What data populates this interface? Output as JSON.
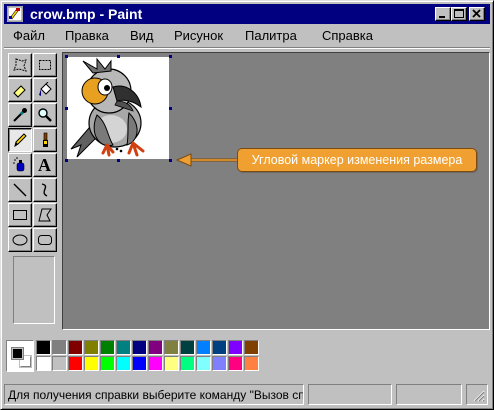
{
  "window": {
    "title": "crow.bmp - Paint",
    "title_bar_color": "#000080",
    "controls": [
      "minimize-icon",
      "maximize-icon",
      "close-icon"
    ]
  },
  "menu": {
    "items": [
      "Файл",
      "Правка",
      "Вид",
      "Рисунок",
      "Палитра",
      "Справка"
    ]
  },
  "toolbox": {
    "tools": [
      "free-form-select-icon",
      "rectangle-select-icon",
      "eraser-icon",
      "fill-bucket-icon",
      "color-picker-icon",
      "magnifier-icon",
      "pencil-icon",
      "brush-icon",
      "airbrush-icon",
      "text-icon",
      "line-icon",
      "curve-icon",
      "rectangle-icon",
      "polygon-icon",
      "ellipse-icon",
      "rounded-rectangle-icon"
    ],
    "active_tool": "pencil-icon",
    "text_tool_glyph": "A"
  },
  "canvas": {
    "image": "crow-drawing",
    "background": "#ffffff"
  },
  "callout": {
    "text": "Угловой маркер изменения размера",
    "color": "#f0a030"
  },
  "colors": {
    "foreground": "#000000",
    "background": "#ffffff",
    "palette_top": [
      "#000000",
      "#808080",
      "#800000",
      "#808000",
      "#008000",
      "#008080",
      "#000080",
      "#800080",
      "#808040",
      "#004040",
      "#0080ff",
      "#004080",
      "#8000ff",
      "#804000"
    ],
    "palette_bottom": [
      "#ffffff",
      "#c0c0c0",
      "#ff0000",
      "#ffff00",
      "#00ff00",
      "#00ffff",
      "#0000ff",
      "#ff00ff",
      "#ffff80",
      "#00ff80",
      "#80ffff",
      "#8080ff",
      "#ff0080",
      "#ff8040"
    ]
  },
  "status": {
    "text": "Для получения справки выберите команду \"Вызов справки\" из меню \"Справка\".",
    "coords": "",
    "size": ""
  }
}
